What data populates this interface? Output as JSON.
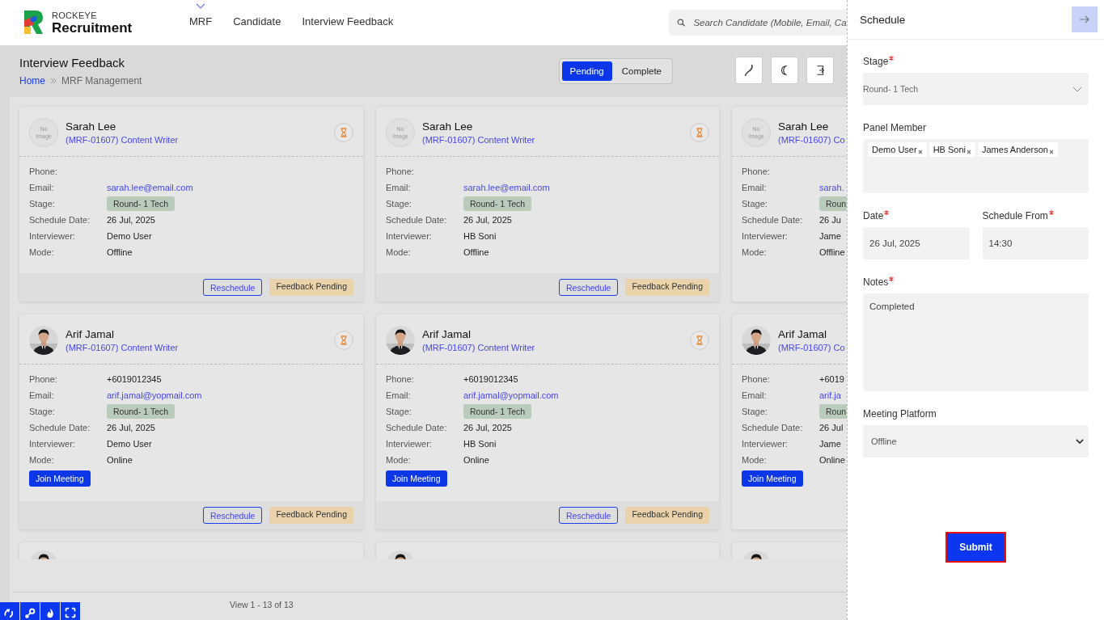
{
  "brand": {
    "small": "ROCKEYE",
    "name": "Recruitment"
  },
  "nav": [
    {
      "label": "MRF",
      "has_menu": true
    },
    {
      "label": "Candidate",
      "has_menu": false
    },
    {
      "label": "Interview Feedback",
      "has_menu": false
    }
  ],
  "search": {
    "placeholder": "Search Candidate (Mobile, Email, Ca"
  },
  "page": {
    "title": "Interview Feedback",
    "breadcrumb": [
      "Home",
      "MRF Management"
    ]
  },
  "status_toggle": [
    {
      "label": "Pending",
      "selected": true
    },
    {
      "label": "Complete",
      "selected": false
    }
  ],
  "cards": [
    {
      "avatar": {
        "kind": "placeholder",
        "text": "No Image"
      },
      "name": "Sarah Lee",
      "role": "(MRF-01607) Content Writer",
      "status_icon": true,
      "rows": [
        {
          "label": "Phone:"
        },
        {
          "label": "Email:",
          "value": "sarah.lee@email.com",
          "kind": "link"
        },
        {
          "label": "Stage:",
          "value": "Round- 1 Tech",
          "kind": "badge"
        },
        {
          "label": "Schedule Date:",
          "value": "26 Jul, 2025",
          "kind": "text"
        },
        {
          "label": "Interviewer:",
          "value": "Demo User",
          "kind": "text"
        },
        {
          "label": "Mode:",
          "value": "Offline",
          "kind": "text"
        }
      ],
      "actions": [
        "Reschedule",
        "Feedback Pending"
      ]
    },
    {
      "avatar": {
        "kind": "placeholder",
        "text": "No Image"
      },
      "name": "Sarah Lee",
      "role": "(MRF-01607) Content Writer",
      "status_icon": true,
      "rows": [
        {
          "label": "Phone:"
        },
        {
          "label": "Email:",
          "value": "sarah.lee@email.com",
          "kind": "link"
        },
        {
          "label": "Stage:",
          "value": "Round- 1 Tech",
          "kind": "badge"
        },
        {
          "label": "Schedule Date:",
          "value": "26 Jul, 2025",
          "kind": "text"
        },
        {
          "label": "Interviewer:",
          "value": "HB Soni",
          "kind": "text"
        },
        {
          "label": "Mode:",
          "value": "Offline",
          "kind": "text"
        }
      ],
      "actions": [
        "Reschedule",
        "Feedback Pending"
      ]
    },
    {
      "avatar": {
        "kind": "placeholder",
        "text": "No Image"
      },
      "name": "Sarah Lee",
      "role": "(MRF-01607) Co",
      "status_icon": false,
      "rows": [
        {
          "label": "Phone:"
        },
        {
          "label": "Email:",
          "value": "sarah.",
          "kind": "link"
        },
        {
          "label": "Stage:",
          "value": "Roun",
          "kind": "badge"
        },
        {
          "label": "Schedule Date:",
          "value": "26 Ju",
          "kind": "text"
        },
        {
          "label": "Interviewer:",
          "value": "Jame",
          "kind": "text"
        },
        {
          "label": "Mode:",
          "value": "Offline",
          "kind": "text"
        }
      ]
    },
    {
      "avatar": {
        "kind": "picture"
      },
      "name": "Arif Jamal",
      "role": "(MRF-01607) Content Writer",
      "status_icon": true,
      "rows": [
        {
          "label": "Phone:",
          "value": "+6019012345",
          "kind": "text"
        },
        {
          "label": "Email:",
          "value": "arif.jamal@yopmail.com",
          "kind": "link"
        },
        {
          "label": "Stage:",
          "value": "Round- 1 Tech",
          "kind": "badge"
        },
        {
          "label": "Schedule Date:",
          "value": "26 Jul, 2025",
          "kind": "text"
        },
        {
          "label": "Interviewer:",
          "value": "Demo User",
          "kind": "text"
        },
        {
          "label": "Mode:",
          "value": "Online",
          "kind": "text"
        }
      ],
      "join_button": "Join Meeting",
      "actions": [
        "Reschedule",
        "Feedback Pending"
      ]
    },
    {
      "avatar": {
        "kind": "picture"
      },
      "name": "Arif Jamal",
      "role": "(MRF-01607) Content Writer",
      "status_icon": true,
      "rows": [
        {
          "label": "Phone:",
          "value": "+6019012345",
          "kind": "text"
        },
        {
          "label": "Email:",
          "value": "arif.jamal@yopmail.com",
          "kind": "link"
        },
        {
          "label": "Stage:",
          "value": "Round- 1 Tech",
          "kind": "badge"
        },
        {
          "label": "Schedule Date:",
          "value": "26 Jul, 2025",
          "kind": "text"
        },
        {
          "label": "Interviewer:",
          "value": "HB Soni",
          "kind": "text"
        },
        {
          "label": "Mode:",
          "value": "Online",
          "kind": "text"
        }
      ],
      "join_button": "Join Meeting",
      "actions": [
        "Reschedule",
        "Feedback Pending"
      ]
    },
    {
      "avatar": {
        "kind": "picture"
      },
      "name": "Arif Jamal",
      "role": "(MRF-01607) Co",
      "status_icon": false,
      "rows": [
        {
          "label": "Phone:",
          "value": "+6019",
          "kind": "text"
        },
        {
          "label": "Email:",
          "value": "arif.ja",
          "kind": "link"
        },
        {
          "label": "Stage:",
          "value": "Roun",
          "kind": "badge"
        },
        {
          "label": "Schedule Date:",
          "value": "26 Jul",
          "kind": "text"
        },
        {
          "label": "Interviewer:",
          "value": "Jame",
          "kind": "text"
        },
        {
          "label": "Mode:",
          "value": "Online",
          "kind": "text"
        }
      ],
      "join_button": "Join Meeting"
    },
    {
      "avatar": {
        "kind": "picture"
      }
    },
    {
      "avatar": {
        "kind": "picture"
      }
    },
    {
      "avatar": {
        "kind": "picture"
      }
    }
  ],
  "pager": {
    "text": "View 1 - 13 of 13"
  },
  "schedule_panel": {
    "title": "Schedule",
    "stage": {
      "label": "Stage",
      "required": true,
      "value": "Round- 1 Tech"
    },
    "panel_member": {
      "label": "Panel Member",
      "required": false,
      "tags": [
        "Demo User",
        "HB Soni",
        "James Anderson"
      ]
    },
    "date": {
      "label": "Date",
      "required": true,
      "value": "26 Jul, 2025"
    },
    "schedule_from": {
      "label": "Schedule From",
      "required": true,
      "value": "14:30"
    },
    "notes": {
      "label": "Notes",
      "required": true,
      "value": "Completed"
    },
    "meeting_platform": {
      "label": "Meeting Platform",
      "required": false,
      "value": "Offline"
    },
    "submit": "Submit"
  }
}
